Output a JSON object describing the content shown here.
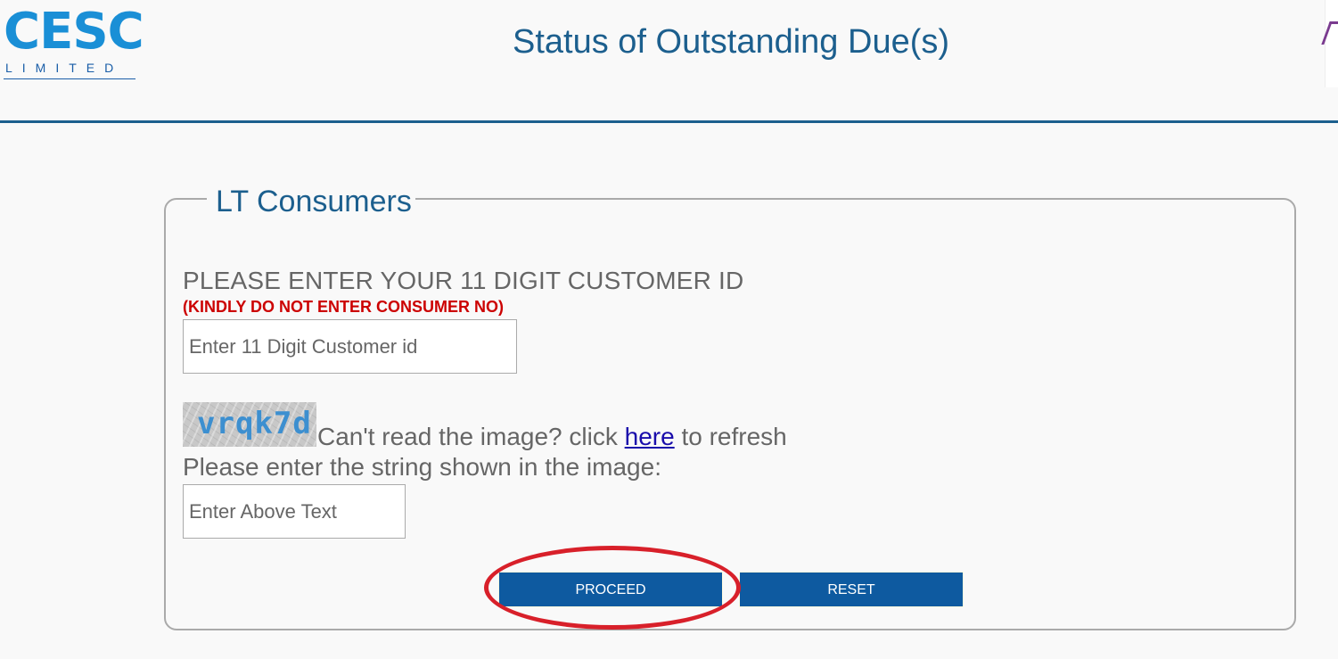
{
  "header": {
    "logo_main": "CESC",
    "logo_sub": "LIMITED",
    "title": "Status of Outstanding Due(s)"
  },
  "form": {
    "legend": "LT Consumers",
    "customer_label": "PLEASE ENTER YOUR 11 DIGIT CUSTOMER ID",
    "customer_warning": "(KINDLY DO NOT ENTER CONSUMER NO)",
    "customer_placeholder": "Enter 11 Digit Customer id",
    "captcha_text": "vrqk7d",
    "refresh_prefix": "Can't read the image? click",
    "refresh_link": "here",
    "refresh_suffix": "to refresh",
    "captcha_label": "Please enter the string shown in the image:",
    "captcha_placeholder": "Enter Above Text",
    "proceed_label": "PROCEED",
    "reset_label": "RESET"
  },
  "colors": {
    "brand_blue": "#1c5f8e",
    "button_blue": "#0e5aa0",
    "warning_red": "#cc0000",
    "highlight_red": "#d8202a"
  }
}
